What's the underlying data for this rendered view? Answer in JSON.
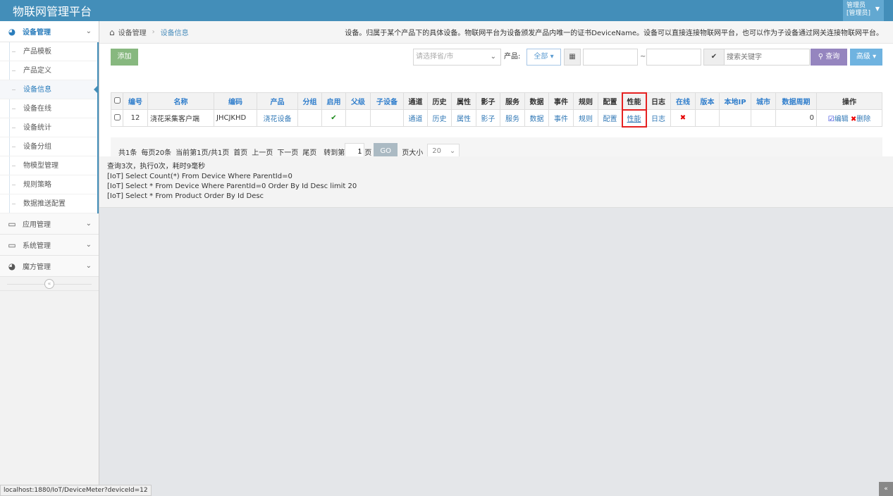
{
  "header": {
    "title": "物联网管理平台",
    "user_name": "管理员",
    "user_role": "[管理员]"
  },
  "sidebar": {
    "top": {
      "label": "设备管理",
      "items": [
        "产品模板",
        "产品定义",
        "设备信息",
        "设备在线",
        "设备统计",
        "设备分组",
        "物模型管理",
        "规则策略",
        "数据推送配置"
      ]
    },
    "groups": [
      "应用管理",
      "系统管理",
      "魔方管理"
    ],
    "collapse": "«"
  },
  "breadcrumb": {
    "root": "设备管理",
    "current": "设备信息",
    "desc": "设备。归属于某个产品下的具体设备。物联网平台为设备颁发产品内唯一的证书DeviceName。设备可以直接连接物联网平台，也可以作为子设备通过网关连接物联网平台。"
  },
  "toolbar": {
    "add": "添加",
    "province_placeholder": "请选择省/市",
    "product_label": "产品:",
    "product_value": "全部",
    "range_sep": "~",
    "search_placeholder": "搜索关键字",
    "query": "查询",
    "advanced": "高级"
  },
  "table": {
    "headers": [
      "编号",
      "名称",
      "编码",
      "产品",
      "分组",
      "启用",
      "父级",
      "子设备",
      "通道",
      "历史",
      "属性",
      "影子",
      "服务",
      "数据",
      "事件",
      "规则",
      "配置",
      "性能",
      "日志",
      "在线",
      "版本",
      "本地IP",
      "城市",
      "数据周期",
      "操作"
    ],
    "rows": [
      {
        "id": "12",
        "name": "浇花采集客户端",
        "code": "JHCJKHD",
        "product": "浇花设备",
        "group": "",
        "enabled": "✔",
        "parent": "",
        "children": "",
        "channel": "通道",
        "history": "历史",
        "props": "属性",
        "shadow": "影子",
        "service": "服务",
        "data": "数据",
        "event": "事件",
        "rule": "规则",
        "config": "配置",
        "perf": "性能",
        "log": "日志",
        "online": "✖",
        "version": "",
        "ip": "",
        "city": "",
        "period": "0",
        "edit": "编辑",
        "delete": "删除"
      }
    ]
  },
  "pager": {
    "total": "共1条",
    "per_page": "每页20条",
    "current": "当前第1页/共1页",
    "first": "首页",
    "prev": "上一页",
    "next": "下一页",
    "last": "尾页",
    "goto": "转到第",
    "page_value": "1",
    "page_unit": "页",
    "go": "GO",
    "size_label": "页大小",
    "size_value": "20"
  },
  "log": [
    "查询3次，执行0次，耗时9毫秒",
    "[IoT] Select Count(*) From Device Where ParentId=0",
    "[IoT] Select * From Device Where ParentId=0 Order By Id Desc limit 20",
    "[IoT] Select * From Product Order By Id Desc"
  ],
  "status_url": "localhost:1880/IoT/DeviceMeter?deviceId=12",
  "colors": {
    "header": "#438eb9",
    "add": "#87b87f",
    "query": "#9585bf",
    "advanced": "#6fb3e0",
    "highlight": "#e52222"
  }
}
